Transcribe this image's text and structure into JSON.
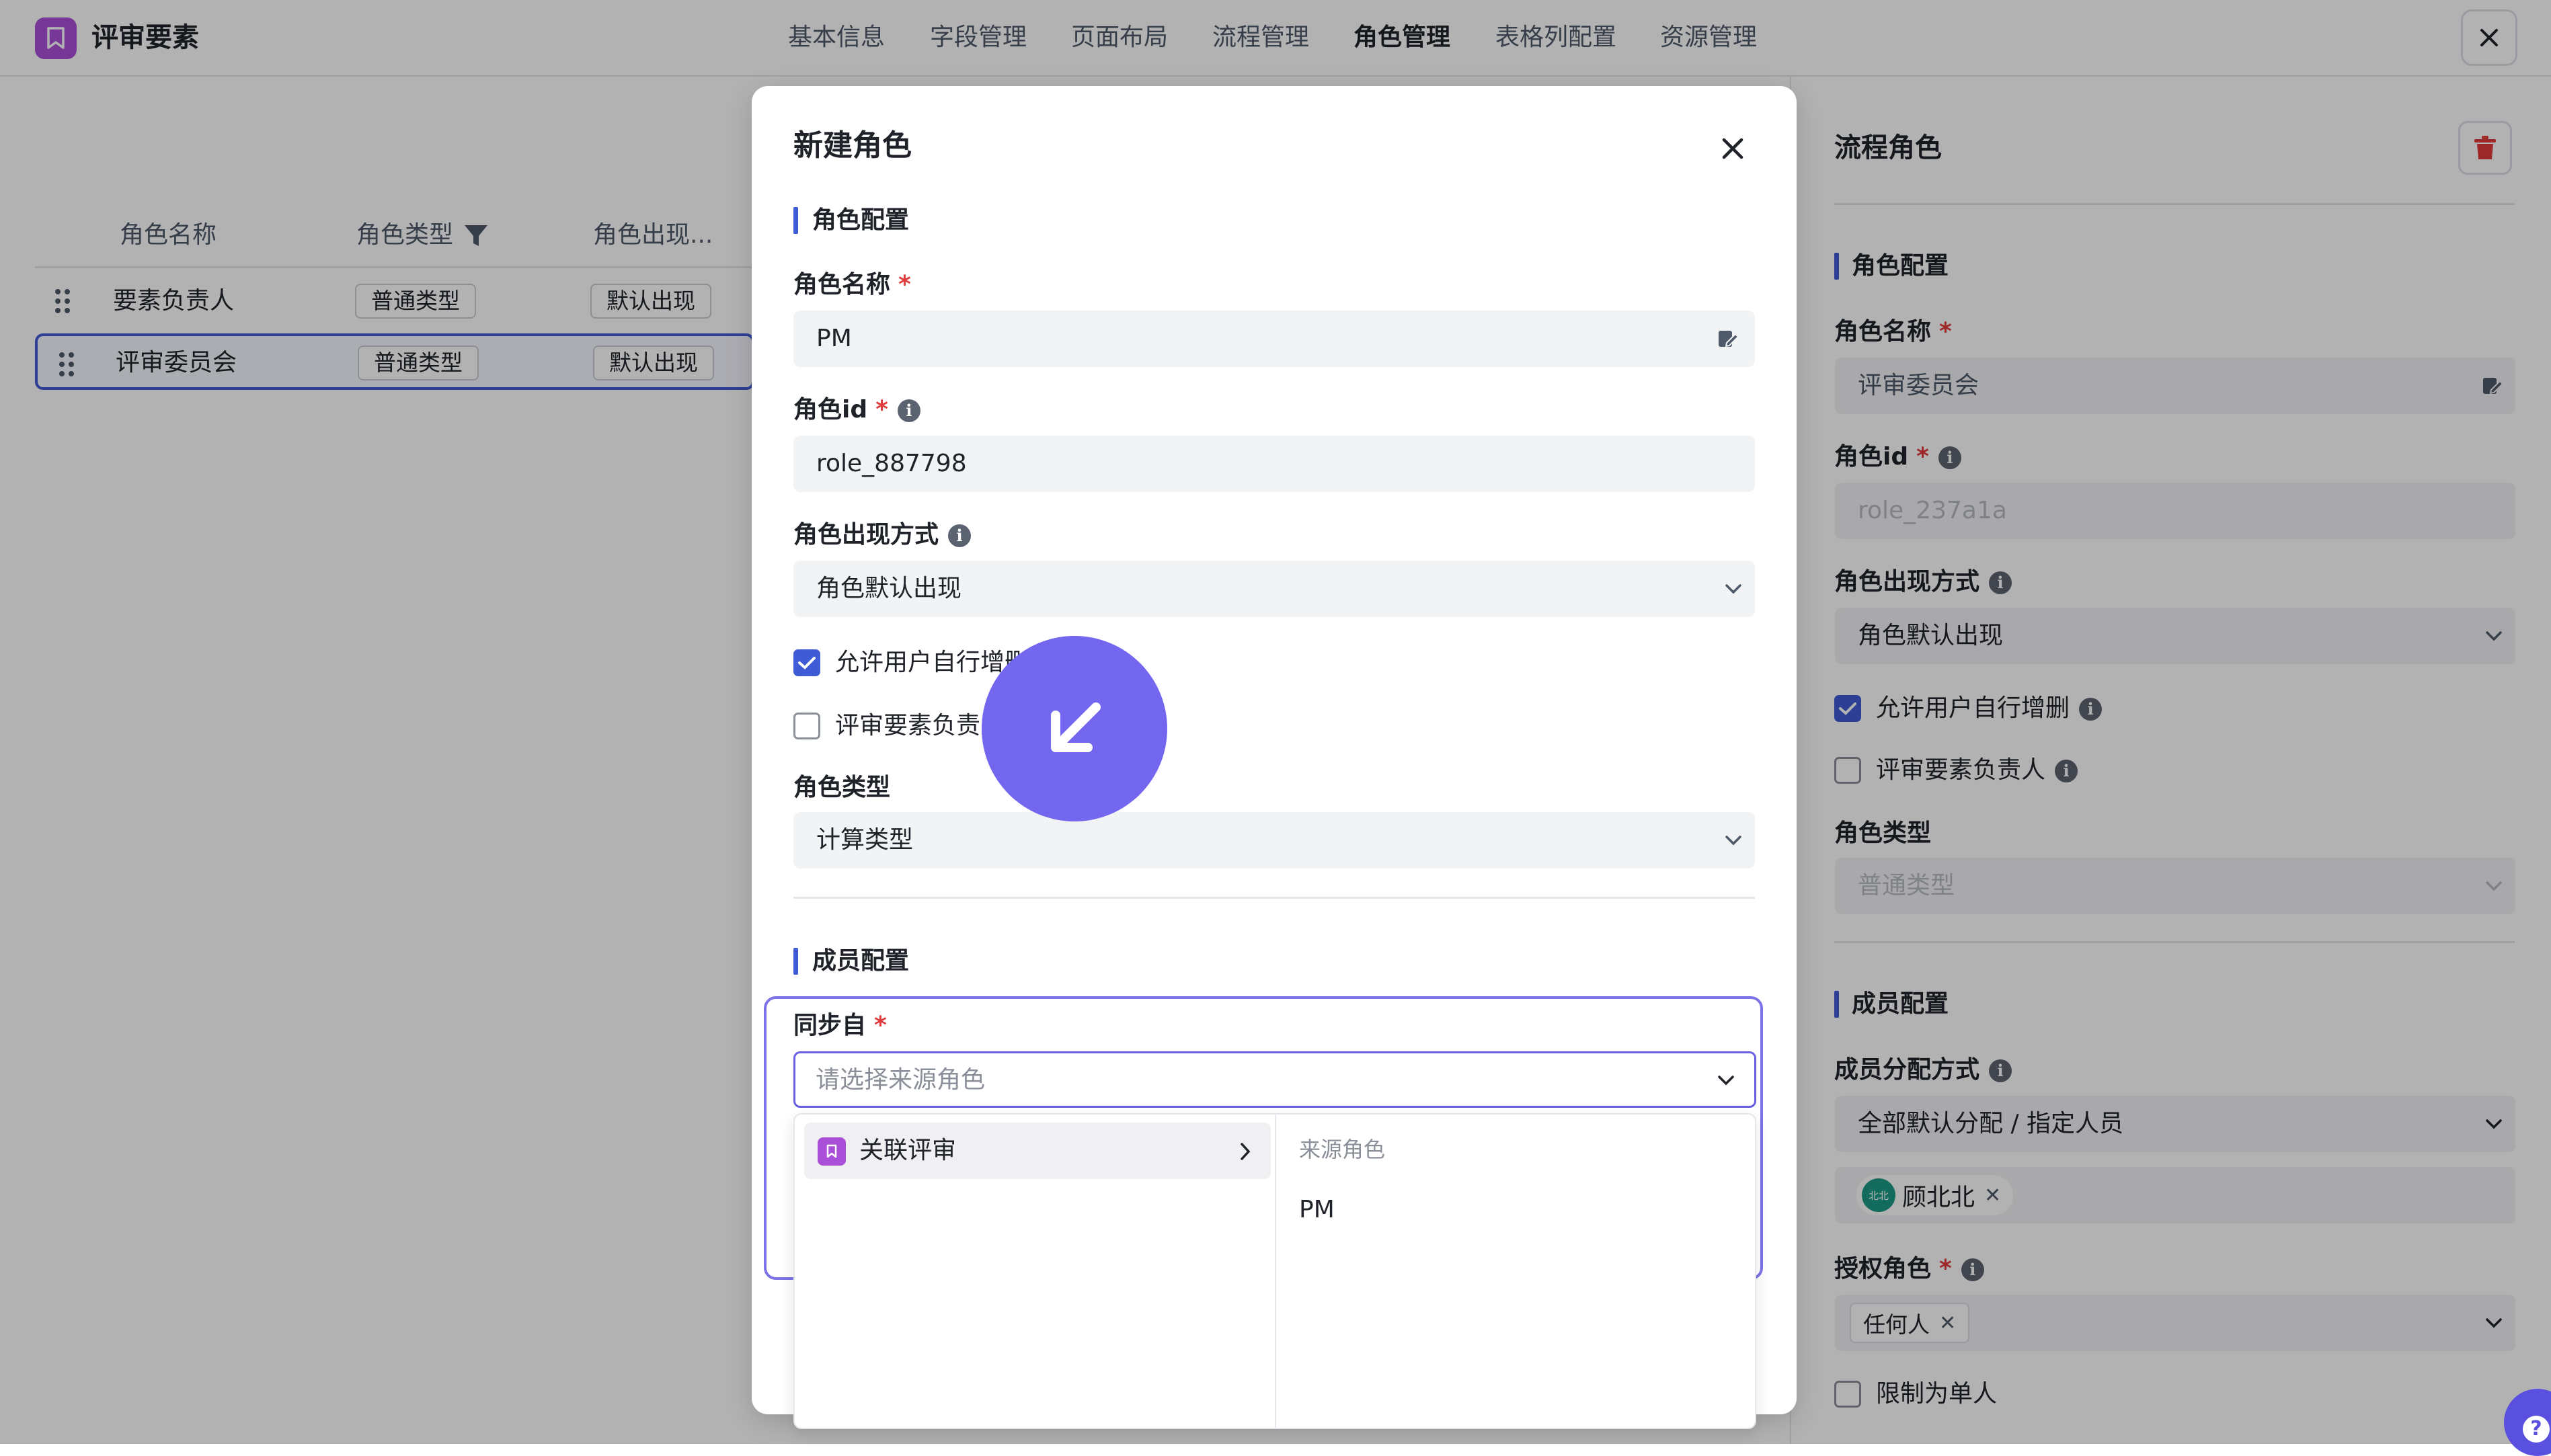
{
  "app": {
    "title": "评审要素"
  },
  "nav": {
    "tabs": [
      {
        "label": "基本信息"
      },
      {
        "label": "字段管理"
      },
      {
        "label": "页面布局"
      },
      {
        "label": "流程管理"
      },
      {
        "label": "角色管理",
        "active": true
      },
      {
        "label": "表格列配置"
      },
      {
        "label": "资源管理"
      }
    ]
  },
  "table": {
    "headers": [
      "角色名称",
      "角色类型",
      "角色出现..."
    ],
    "rows": [
      {
        "name": "要素负责人",
        "type": "普通类型",
        "appear": "默认出现"
      },
      {
        "name": "评审委员会",
        "type": "普通类型",
        "appear": "默认出现",
        "selected": true
      }
    ]
  },
  "modal": {
    "title": "新建角色",
    "section_role": "角色配置",
    "name_label": "角色名称",
    "name_value": "PM",
    "id_label": "角色id",
    "id_value": "role_887798",
    "appear_label": "角色出现方式",
    "appear_value": "角色默认出现",
    "cb_allow_label": "允许用户自行增删",
    "cb_allow_checked": true,
    "cb_owner_label": "评审要素负责人",
    "cb_owner_checked": false,
    "type_label": "角色类型",
    "type_value": "计算类型",
    "section_member": "成员配置",
    "sync_label": "同步自",
    "sync_placeholder": "请选择来源角色",
    "cascader": {
      "left_item": "关联评审",
      "right_header": "来源角色",
      "right_option": "PM"
    }
  },
  "panel": {
    "title": "流程角色",
    "section_role": "角色配置",
    "name_label": "角色名称",
    "name_value": "评审委员会",
    "id_label": "角色id",
    "id_value": "role_237a1a",
    "appear_label": "角色出现方式",
    "appear_value": "角色默认出现",
    "cb_allow_label": "允许用户自行增删",
    "cb_owner_label": "评审要素负责人",
    "type_label": "角色类型",
    "type_value": "普通类型",
    "section_member": "成员配置",
    "assign_label": "成员分配方式",
    "assign_value": "全部默认分配 / 指定人员",
    "member_avatar_text": "北北",
    "member_name": "顾北北",
    "auth_label": "授权角色",
    "auth_value": "任何人",
    "cb_single_label": "限制为单人"
  },
  "colors": {
    "accent": "#3f5bd6",
    "brand": "#a94fd8",
    "required": "#e03a3a",
    "floating": "#7367f0",
    "danger": "#e03a3a"
  },
  "icons": [
    "bookmark-icon",
    "close-icon",
    "filter-icon",
    "drag-handle-icon",
    "edit-icon",
    "info-icon",
    "chevron-down-icon",
    "chevron-right-icon",
    "check-icon",
    "trash-icon",
    "arrow-down-left-icon",
    "help-icon"
  ]
}
